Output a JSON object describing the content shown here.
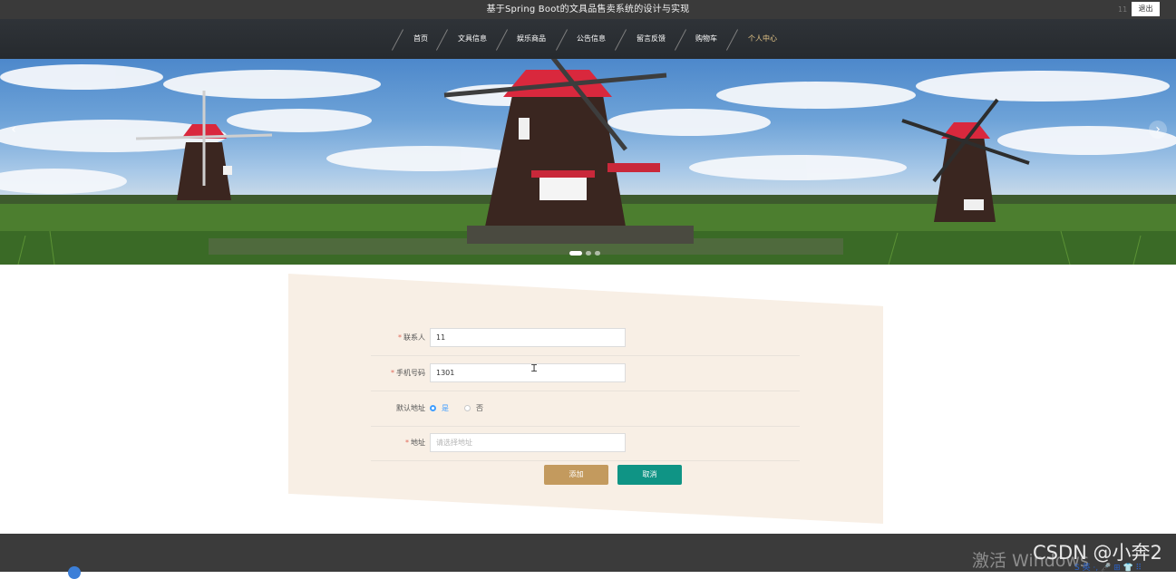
{
  "top_bar": {
    "title": "基于Spring Boot的文具品售卖系统的设计与实现",
    "username": "11",
    "logout_label": "退出"
  },
  "nav": {
    "items": [
      {
        "label": "首页"
      },
      {
        "label": "文具信息"
      },
      {
        "label": "娱乐商品"
      },
      {
        "label": "公告信息"
      },
      {
        "label": "留言反馈"
      },
      {
        "label": "购物车"
      },
      {
        "label": "个人中心"
      }
    ],
    "active_label": "个人中心"
  },
  "banner": {
    "prev_icon": "chevron-left-icon",
    "next_icon": "chevron-right-icon",
    "slide_count": 3,
    "active_slide": 1
  },
  "form": {
    "contact": {
      "label": "联系人",
      "value": "11"
    },
    "phone": {
      "label": "手机号码",
      "value": "1301"
    },
    "default_address": {
      "label": "默认地址",
      "options": [
        "是",
        "否"
      ],
      "selected": "是"
    },
    "address": {
      "label": "地址",
      "value": "",
      "placeholder": "请选择地址"
    },
    "add_label": "添加",
    "cancel_label": "取消"
  },
  "overlay": {
    "windows_watermark": "激活 Windows",
    "csdn_watermark": "CSDN @小奔2",
    "ime_text": "S 英 ·, 🎤 ⊞ 👕 ⠿"
  },
  "colors": {
    "accent_brown": "#c39a5e",
    "accent_teal": "#0f9485",
    "active_nav": "#e9c98a",
    "form_background": "#f8efe5",
    "radio_selected": "#409eff"
  }
}
